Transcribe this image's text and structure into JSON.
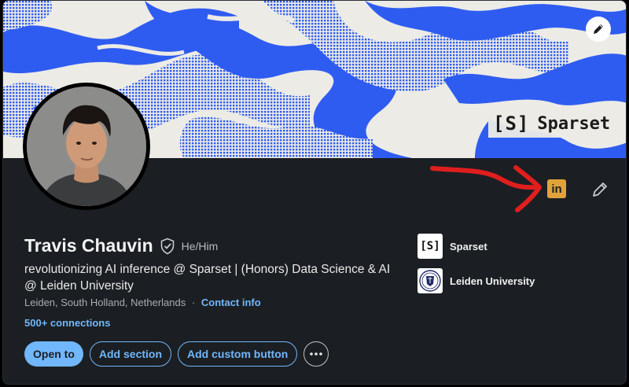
{
  "banner": {
    "logo_bracket": "[S]",
    "logo_text": "Sparset",
    "edit_icon": "pencil-icon"
  },
  "profile": {
    "name": "Travis Chauvin",
    "pronouns": "He/Him",
    "headline": "revolutionizing AI inference @ Sparset | (Honors) Data Science & AI @ Leiden University",
    "location": "Leiden, South Holland, Netherlands",
    "location_separator": "·",
    "contact_info": "Contact info",
    "connections": "500+ connections",
    "verified_icon": "verified-shield-icon"
  },
  "header_icons": {
    "linkedin_label": "in",
    "linkedin_icon": "linkedin-icon",
    "edit_icon": "pencil-icon"
  },
  "organizations": [
    {
      "logo": "[S]",
      "name": "Sparset"
    },
    {
      "logo": "leiden-seal",
      "name": "Leiden University"
    }
  ],
  "actions": {
    "open_to": "Open to",
    "add_section": "Add section",
    "add_custom_button": "Add custom button",
    "more": "•••"
  },
  "colors": {
    "background": "#1b1f23",
    "accent": "#71b7fb",
    "banner_blue": "#2f5cf0",
    "linkedin_badge": "#e0a33a",
    "annotation_red": "#e01e1e"
  }
}
